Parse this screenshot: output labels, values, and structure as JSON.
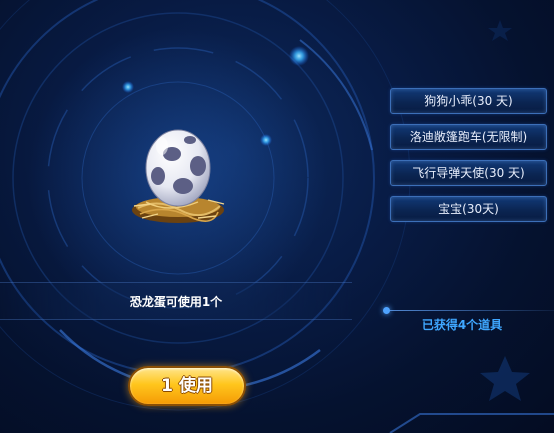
{
  "reward_list": {
    "items": [
      {
        "label": "狗狗小乖(30 天)"
      },
      {
        "label": "洛迪敞篷跑车(无限制)"
      },
      {
        "label": "飞行导弹天使(30 天)"
      },
      {
        "label": "宝宝(30天)"
      }
    ]
  },
  "featured_item": {
    "caption": "恐龙蛋可使用1个",
    "icon": "dinosaur-egg-in-nest"
  },
  "summary": {
    "obtained_text": "已获得4个道具"
  },
  "action": {
    "use_label": "1 使用"
  },
  "colors": {
    "background": "#071a40",
    "item_border": "#3c6fb8",
    "count_text": "#3fa7ff",
    "button_gold": "#ffc61d"
  }
}
